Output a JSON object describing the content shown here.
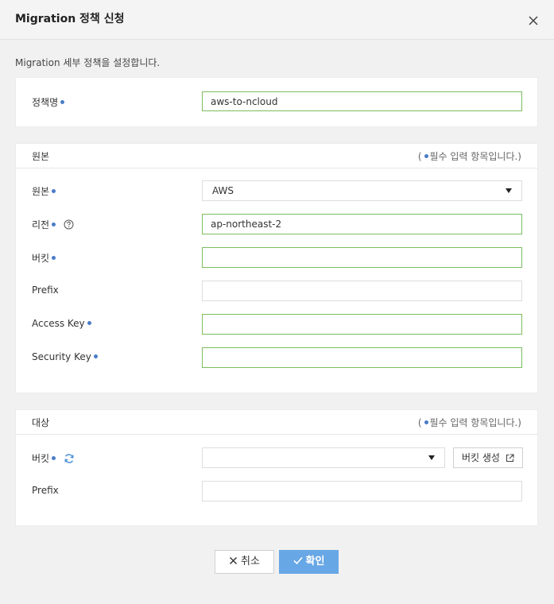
{
  "dialog": {
    "title": "Migration 정책 신청",
    "description": "Migration 세부 정책을 설정합니다."
  },
  "policy": {
    "name_label": "정책명",
    "name_value": "aws-to-ncloud"
  },
  "source": {
    "section_title": "원본",
    "required_note_open": "(",
    "required_note_text": "필수 입력 항목입니다.)",
    "origin_label": "원본",
    "origin_value": "AWS",
    "region_label": "리전",
    "region_value": "ap-northeast-2",
    "bucket_label": "버킷",
    "bucket_value": "",
    "prefix_label": "Prefix",
    "prefix_value": "",
    "access_key_label": "Access Key",
    "access_key_value": "",
    "security_key_label": "Security Key",
    "security_key_value": ""
  },
  "target": {
    "section_title": "대상",
    "required_note_open": "(",
    "required_note_text": "필수 입력 항목입니다.)",
    "bucket_label": "버킷",
    "bucket_value": "",
    "create_bucket_label": "버킷 생성",
    "prefix_label": "Prefix",
    "prefix_value": ""
  },
  "actions": {
    "cancel_label": "취소",
    "confirm_label": "확인"
  },
  "colors": {
    "accent": "#68a7e5",
    "required_dot": "#4a7cc9",
    "valid_border": "#7cbd5e"
  },
  "icons": {
    "close": "close-icon",
    "help": "help-icon",
    "refresh": "refresh-icon",
    "external_link": "external-link-icon",
    "check": "check-icon",
    "cancel": "x-icon"
  }
}
